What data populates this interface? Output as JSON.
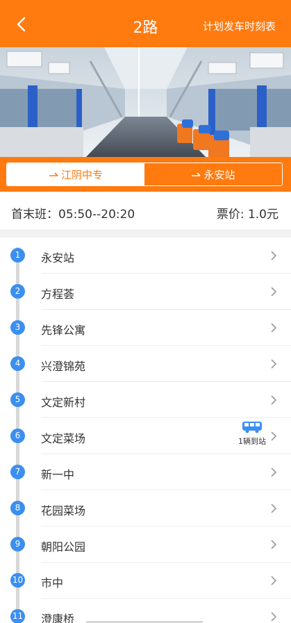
{
  "header": {
    "title": "2路",
    "schedule_link": "计划发车时刻表"
  },
  "directions": [
    {
      "label": "江阴中专",
      "active": true
    },
    {
      "label": "永安站",
      "active": false
    }
  ],
  "info": {
    "hours": "首末班：05:50--20:20",
    "fare": "票价: 1.0元"
  },
  "stops": [
    {
      "num": "1",
      "name": "永安站"
    },
    {
      "num": "2",
      "name": "方程荟"
    },
    {
      "num": "3",
      "name": "先锋公寓"
    },
    {
      "num": "4",
      "name": "兴澄锦苑"
    },
    {
      "num": "5",
      "name": "文定新村"
    },
    {
      "num": "6",
      "name": "文定菜场",
      "bus_status": "1辆到站"
    },
    {
      "num": "7",
      "name": "新一中"
    },
    {
      "num": "8",
      "name": "花园菜场"
    },
    {
      "num": "9",
      "name": "朝阳公园"
    },
    {
      "num": "10",
      "name": "市中"
    },
    {
      "num": "11",
      "name": "澄康桥"
    }
  ],
  "colors": {
    "brand": "#ff7a0f",
    "stop_badge": "#3b8ff0",
    "bus_icon": "#3b8ff0"
  },
  "icons": [
    "back-arrow-icon",
    "direction-arrow-icon",
    "chevron-right-icon",
    "bus-icon"
  ]
}
